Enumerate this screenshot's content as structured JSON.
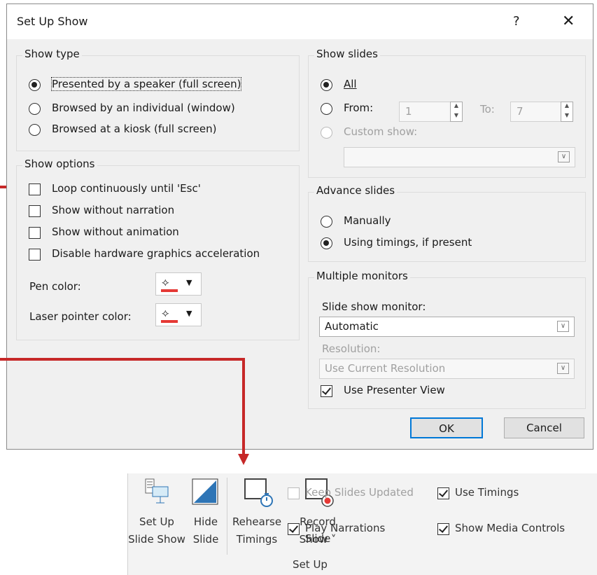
{
  "dialog": {
    "title": "Set Up Show",
    "help": "?",
    "close": "✕",
    "show_type": {
      "label": "Show type",
      "options": [
        "Presented by a speaker (full screen)",
        "Browsed by an individual (window)",
        "Browsed at a kiosk (full screen)"
      ],
      "selected": 0
    },
    "show_options": {
      "label": "Show options",
      "checks": [
        "Loop continuously until 'Esc'",
        "Show without narration",
        "Show without animation",
        "Disable hardware graphics acceleration"
      ],
      "pen_color_label": "Pen color:",
      "laser_color_label": "Laser pointer color:",
      "pen_color": "#e53935",
      "laser_color": "#e53935"
    },
    "show_slides": {
      "label": "Show slides",
      "all": "All",
      "from": "From:",
      "from_value": "1",
      "to": "To:",
      "to_value": "7",
      "custom_show": "Custom show:"
    },
    "advance_slides": {
      "label": "Advance slides",
      "manually": "Manually",
      "using_timings": "Using timings, if present"
    },
    "multiple_monitors": {
      "label": "Multiple monitors",
      "monitor_label": "Slide show monitor:",
      "monitor_value": "Automatic",
      "resolution_label": "Resolution:",
      "resolution_value": "Use Current Resolution",
      "presenter_view": "Use Presenter View"
    },
    "ok": "OK",
    "cancel": "Cancel"
  },
  "ribbon": {
    "setup_slideshow": [
      "Set Up",
      "Slide Show"
    ],
    "hide_slide": [
      "Hide",
      "Slide"
    ],
    "rehearse_timings": [
      "Rehearse",
      "Timings"
    ],
    "record_slide_show": [
      "Record Slide",
      "Show ˅"
    ],
    "keep_slides_updated": "Keep Slides Updated",
    "play_narrations": "Play Narrations",
    "use_timings": "Use Timings",
    "show_media_controls": "Show Media Controls",
    "group_label": "Set Up"
  },
  "colors": {
    "callout": "#c62828",
    "default_button_border": "#0078d7"
  }
}
